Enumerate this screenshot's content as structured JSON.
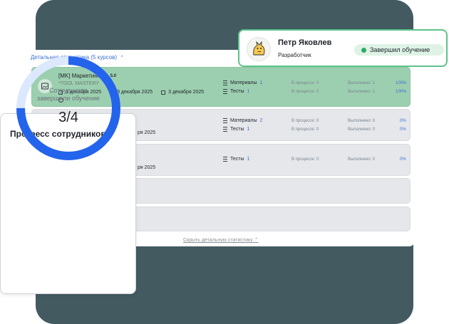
{
  "stats": {
    "header": "Детальная статистика (5 курсов)",
    "hide_link": "Скрыть детальную статистику"
  },
  "courses": [
    {
      "title": "[MK] Маркетинг",
      "rating": "5.0",
      "subtitle": "*TOOL MASTERY",
      "dates": [
        "3 декабря 2025",
        "3 декабря 2025",
        "3 декабря 2025"
      ],
      "materials": {
        "label": "Материалы",
        "count": "1",
        "in_progress": "В процессе: 0",
        "done": "Выполнено: 1",
        "percent": "100%"
      },
      "tests": {
        "label": "Тесты",
        "count": "1",
        "in_progress": "В процессе: 0",
        "done": "Выполнено: 1",
        "percent": "100%"
      }
    },
    {
      "date_tail": "ря 2025",
      "materials": {
        "label": "Материалы",
        "count": "2",
        "in_progress": "В процессе: 0",
        "done": "Выполнено: 0",
        "percent": "0%"
      },
      "tests": {
        "label": "Тесты",
        "count": "1",
        "in_progress": "В процессе: 0",
        "done": "Выполнено: 0",
        "percent": "0%"
      }
    },
    {
      "date_tail": "ря 2025",
      "tests": {
        "label": "Тесты",
        "count": "1",
        "in_progress": "В процессе: 0",
        "done": "Выполнено: 0",
        "percent": "0%"
      }
    }
  ],
  "profile": {
    "name": "Петр Яковлев",
    "role": "Разработчик",
    "status": "Завершил обучение",
    "status_color": "#2fa866"
  },
  "progress": {
    "title": "Прогресс сотрудников",
    "caption": "Сотрудников завершили обучение",
    "value": "3/4",
    "fraction": 0.75,
    "color": "#2463eb",
    "track_color": "#dbe8fd"
  }
}
